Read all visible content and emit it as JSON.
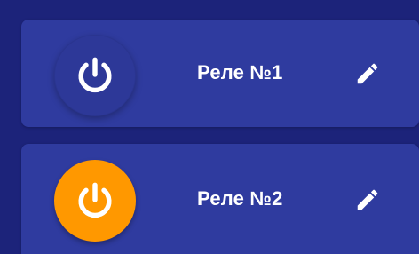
{
  "relays": [
    {
      "name": "Реле №1",
      "state": "off",
      "icon": "power-icon",
      "edit_icon": "pencil-icon",
      "color": "#2d3898"
    },
    {
      "name": "Реле №2",
      "state": "on",
      "icon": "power-icon",
      "edit_icon": "pencil-icon",
      "color": "#ff9800"
    }
  ],
  "colors": {
    "background": "#1c237a",
    "card": "#2f3b9f",
    "text": "#ffffff",
    "active": "#ff9800"
  }
}
